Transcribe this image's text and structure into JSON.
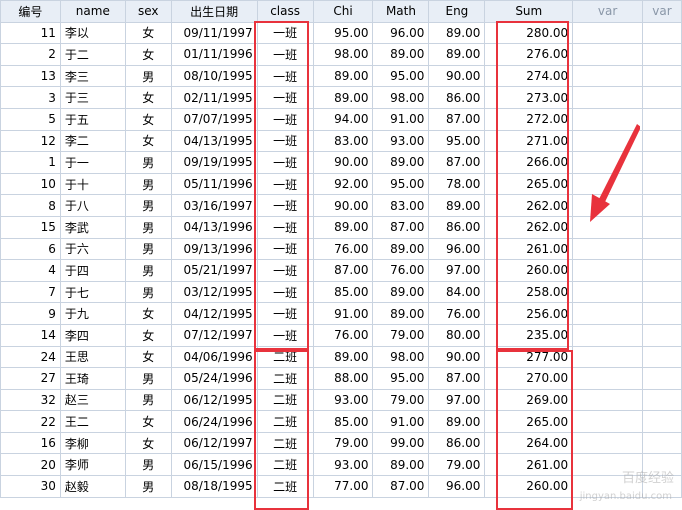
{
  "columns": [
    "编号",
    "name",
    "sex",
    "出生日期",
    "class",
    "Chi",
    "Math",
    "Eng",
    "Sum",
    "var",
    "var"
  ],
  "rows": [
    [
      "11",
      "李以",
      "女",
      "09/11/1997",
      "一班",
      "95.00",
      "96.00",
      "89.00",
      "280.00"
    ],
    [
      "2",
      "于二",
      "女",
      "01/11/1996",
      "一班",
      "98.00",
      "89.00",
      "89.00",
      "276.00"
    ],
    [
      "13",
      "李三",
      "男",
      "08/10/1995",
      "一班",
      "89.00",
      "95.00",
      "90.00",
      "274.00"
    ],
    [
      "3",
      "于三",
      "女",
      "02/11/1995",
      "一班",
      "89.00",
      "98.00",
      "86.00",
      "273.00"
    ],
    [
      "5",
      "于五",
      "女",
      "07/07/1995",
      "一班",
      "94.00",
      "91.00",
      "87.00",
      "272.00"
    ],
    [
      "12",
      "李二",
      "女",
      "04/13/1995",
      "一班",
      "83.00",
      "93.00",
      "95.00",
      "271.00"
    ],
    [
      "1",
      "于一",
      "男",
      "09/19/1995",
      "一班",
      "90.00",
      "89.00",
      "87.00",
      "266.00"
    ],
    [
      "10",
      "于十",
      "男",
      "05/11/1996",
      "一班",
      "92.00",
      "95.00",
      "78.00",
      "265.00"
    ],
    [
      "8",
      "于八",
      "男",
      "03/16/1997",
      "一班",
      "90.00",
      "83.00",
      "89.00",
      "262.00"
    ],
    [
      "15",
      "李武",
      "男",
      "04/13/1996",
      "一班",
      "89.00",
      "87.00",
      "86.00",
      "262.00"
    ],
    [
      "6",
      "于六",
      "男",
      "09/13/1996",
      "一班",
      "76.00",
      "89.00",
      "96.00",
      "261.00"
    ],
    [
      "4",
      "于四",
      "男",
      "05/21/1997",
      "一班",
      "87.00",
      "76.00",
      "97.00",
      "260.00"
    ],
    [
      "7",
      "于七",
      "男",
      "03/12/1995",
      "一班",
      "85.00",
      "89.00",
      "84.00",
      "258.00"
    ],
    [
      "9",
      "于九",
      "女",
      "04/12/1995",
      "一班",
      "91.00",
      "89.00",
      "76.00",
      "256.00"
    ],
    [
      "14",
      "李四",
      "女",
      "07/12/1997",
      "一班",
      "76.00",
      "79.00",
      "80.00",
      "235.00"
    ],
    [
      "24",
      "王思",
      "女",
      "04/06/1996",
      "二班",
      "89.00",
      "98.00",
      "90.00",
      "277.00"
    ],
    [
      "27",
      "王琦",
      "男",
      "05/24/1996",
      "二班",
      "88.00",
      "95.00",
      "87.00",
      "270.00"
    ],
    [
      "32",
      "赵三",
      "男",
      "06/12/1995",
      "二班",
      "93.00",
      "79.00",
      "97.00",
      "269.00"
    ],
    [
      "22",
      "王二",
      "女",
      "06/24/1996",
      "二班",
      "85.00",
      "91.00",
      "89.00",
      "265.00"
    ],
    [
      "16",
      "李柳",
      "女",
      "06/12/1997",
      "二班",
      "79.00",
      "99.00",
      "86.00",
      "264.00"
    ],
    [
      "20",
      "李师",
      "男",
      "06/15/1996",
      "二班",
      "93.00",
      "89.00",
      "79.00",
      "261.00"
    ],
    [
      "30",
      "赵毅",
      "男",
      "08/18/1995",
      "二班",
      "77.00",
      "87.00",
      "96.00",
      "260.00"
    ]
  ],
  "watermark": {
    "brand": "百度经验",
    "url": "jingyan.baidu.com"
  },
  "colors": {
    "highlight_red": "#e8323c",
    "header_bg": "#e8eef6",
    "grid": "#c9d3e0"
  }
}
